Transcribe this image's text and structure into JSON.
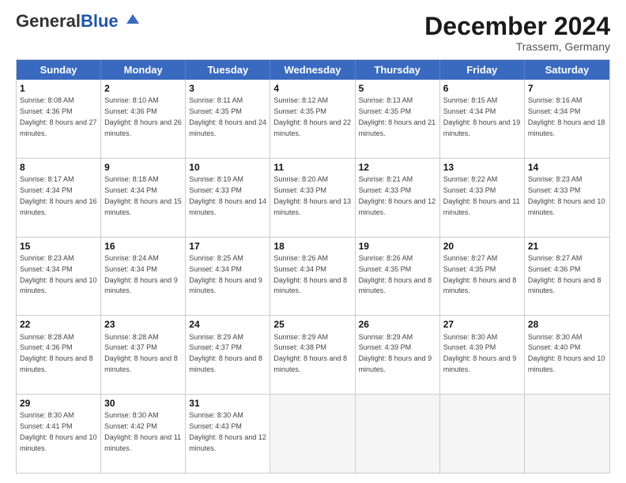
{
  "header": {
    "logo_general": "General",
    "logo_blue": "Blue",
    "month_title": "December 2024",
    "location": "Trassem, Germany"
  },
  "weekdays": [
    "Sunday",
    "Monday",
    "Tuesday",
    "Wednesday",
    "Thursday",
    "Friday",
    "Saturday"
  ],
  "rows": [
    [
      {
        "day": "1",
        "sunrise": "Sunrise: 8:08 AM",
        "sunset": "Sunset: 4:36 PM",
        "daylight": "Daylight: 8 hours and 27 minutes."
      },
      {
        "day": "2",
        "sunrise": "Sunrise: 8:10 AM",
        "sunset": "Sunset: 4:36 PM",
        "daylight": "Daylight: 8 hours and 26 minutes."
      },
      {
        "day": "3",
        "sunrise": "Sunrise: 8:11 AM",
        "sunset": "Sunset: 4:35 PM",
        "daylight": "Daylight: 8 hours and 24 minutes."
      },
      {
        "day": "4",
        "sunrise": "Sunrise: 8:12 AM",
        "sunset": "Sunset: 4:35 PM",
        "daylight": "Daylight: 8 hours and 22 minutes."
      },
      {
        "day": "5",
        "sunrise": "Sunrise: 8:13 AM",
        "sunset": "Sunset: 4:35 PM",
        "daylight": "Daylight: 8 hours and 21 minutes."
      },
      {
        "day": "6",
        "sunrise": "Sunrise: 8:15 AM",
        "sunset": "Sunset: 4:34 PM",
        "daylight": "Daylight: 8 hours and 19 minutes."
      },
      {
        "day": "7",
        "sunrise": "Sunrise: 8:16 AM",
        "sunset": "Sunset: 4:34 PM",
        "daylight": "Daylight: 8 hours and 18 minutes."
      }
    ],
    [
      {
        "day": "8",
        "sunrise": "Sunrise: 8:17 AM",
        "sunset": "Sunset: 4:34 PM",
        "daylight": "Daylight: 8 hours and 16 minutes."
      },
      {
        "day": "9",
        "sunrise": "Sunrise: 8:18 AM",
        "sunset": "Sunset: 4:34 PM",
        "daylight": "Daylight: 8 hours and 15 minutes."
      },
      {
        "day": "10",
        "sunrise": "Sunrise: 8:19 AM",
        "sunset": "Sunset: 4:33 PM",
        "daylight": "Daylight: 8 hours and 14 minutes."
      },
      {
        "day": "11",
        "sunrise": "Sunrise: 8:20 AM",
        "sunset": "Sunset: 4:33 PM",
        "daylight": "Daylight: 8 hours and 13 minutes."
      },
      {
        "day": "12",
        "sunrise": "Sunrise: 8:21 AM",
        "sunset": "Sunset: 4:33 PM",
        "daylight": "Daylight: 8 hours and 12 minutes."
      },
      {
        "day": "13",
        "sunrise": "Sunrise: 8:22 AM",
        "sunset": "Sunset: 4:33 PM",
        "daylight": "Daylight: 8 hours and 11 minutes."
      },
      {
        "day": "14",
        "sunrise": "Sunrise: 8:23 AM",
        "sunset": "Sunset: 4:33 PM",
        "daylight": "Daylight: 8 hours and 10 minutes."
      }
    ],
    [
      {
        "day": "15",
        "sunrise": "Sunrise: 8:23 AM",
        "sunset": "Sunset: 4:34 PM",
        "daylight": "Daylight: 8 hours and 10 minutes."
      },
      {
        "day": "16",
        "sunrise": "Sunrise: 8:24 AM",
        "sunset": "Sunset: 4:34 PM",
        "daylight": "Daylight: 8 hours and 9 minutes."
      },
      {
        "day": "17",
        "sunrise": "Sunrise: 8:25 AM",
        "sunset": "Sunset: 4:34 PM",
        "daylight": "Daylight: 8 hours and 9 minutes."
      },
      {
        "day": "18",
        "sunrise": "Sunrise: 8:26 AM",
        "sunset": "Sunset: 4:34 PM",
        "daylight": "Daylight: 8 hours and 8 minutes."
      },
      {
        "day": "19",
        "sunrise": "Sunrise: 8:26 AM",
        "sunset": "Sunset: 4:35 PM",
        "daylight": "Daylight: 8 hours and 8 minutes."
      },
      {
        "day": "20",
        "sunrise": "Sunrise: 8:27 AM",
        "sunset": "Sunset: 4:35 PM",
        "daylight": "Daylight: 8 hours and 8 minutes."
      },
      {
        "day": "21",
        "sunrise": "Sunrise: 8:27 AM",
        "sunset": "Sunset: 4:36 PM",
        "daylight": "Daylight: 8 hours and 8 minutes."
      }
    ],
    [
      {
        "day": "22",
        "sunrise": "Sunrise: 8:28 AM",
        "sunset": "Sunset: 4:36 PM",
        "daylight": "Daylight: 8 hours and 8 minutes."
      },
      {
        "day": "23",
        "sunrise": "Sunrise: 8:28 AM",
        "sunset": "Sunset: 4:37 PM",
        "daylight": "Daylight: 8 hours and 8 minutes."
      },
      {
        "day": "24",
        "sunrise": "Sunrise: 8:29 AM",
        "sunset": "Sunset: 4:37 PM",
        "daylight": "Daylight: 8 hours and 8 minutes."
      },
      {
        "day": "25",
        "sunrise": "Sunrise: 8:29 AM",
        "sunset": "Sunset: 4:38 PM",
        "daylight": "Daylight: 8 hours and 8 minutes."
      },
      {
        "day": "26",
        "sunrise": "Sunrise: 8:29 AM",
        "sunset": "Sunset: 4:39 PM",
        "daylight": "Daylight: 8 hours and 9 minutes."
      },
      {
        "day": "27",
        "sunrise": "Sunrise: 8:30 AM",
        "sunset": "Sunset: 4:39 PM",
        "daylight": "Daylight: 8 hours and 9 minutes."
      },
      {
        "day": "28",
        "sunrise": "Sunrise: 8:30 AM",
        "sunset": "Sunset: 4:40 PM",
        "daylight": "Daylight: 8 hours and 10 minutes."
      }
    ],
    [
      {
        "day": "29",
        "sunrise": "Sunrise: 8:30 AM",
        "sunset": "Sunset: 4:41 PM",
        "daylight": "Daylight: 8 hours and 10 minutes."
      },
      {
        "day": "30",
        "sunrise": "Sunrise: 8:30 AM",
        "sunset": "Sunset: 4:42 PM",
        "daylight": "Daylight: 8 hours and 11 minutes."
      },
      {
        "day": "31",
        "sunrise": "Sunrise: 8:30 AM",
        "sunset": "Sunset: 4:43 PM",
        "daylight": "Daylight: 8 hours and 12 minutes."
      },
      null,
      null,
      null,
      null
    ]
  ]
}
